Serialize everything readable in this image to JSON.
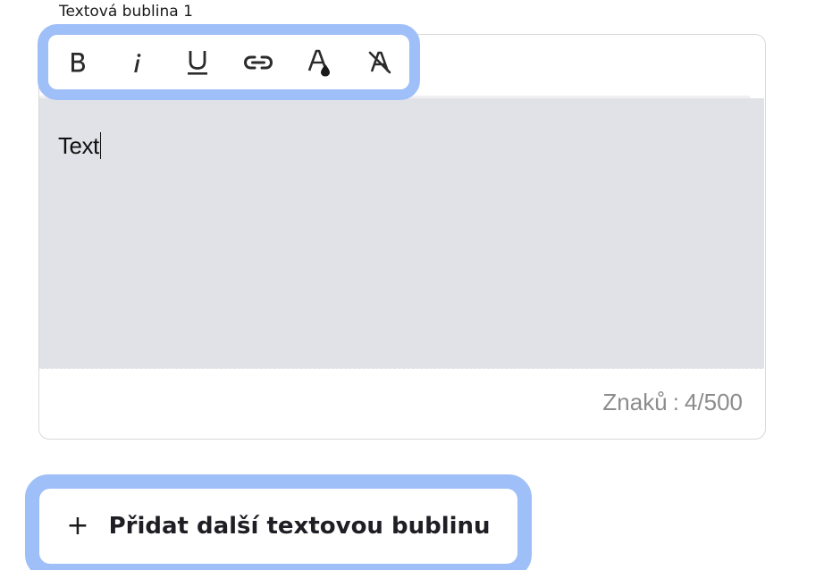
{
  "field": {
    "label": "Textová bublina 1"
  },
  "editor": {
    "text": "Text",
    "counter_label": "Znaků",
    "counter_sep": ":",
    "counter_value": "4/500"
  },
  "toolbar": {
    "items": [
      {
        "name": "bold",
        "icon": "bold-icon"
      },
      {
        "name": "italic",
        "icon": "italic-icon"
      },
      {
        "name": "underline",
        "icon": "underline-icon"
      },
      {
        "name": "link",
        "icon": "link-icon"
      },
      {
        "name": "text-color",
        "icon": "text-color-icon"
      },
      {
        "name": "clear-format",
        "icon": "clear-format-icon"
      }
    ]
  },
  "add_button": {
    "icon": "plus-icon",
    "plus_glyph": "+",
    "label": "Přidat další textovou bublinu"
  },
  "colors": {
    "highlight": "#9fbff8",
    "editor_bg": "#e1e2e7",
    "counter_text": "#8c8c8c",
    "card_border": "#d9d9d9"
  }
}
